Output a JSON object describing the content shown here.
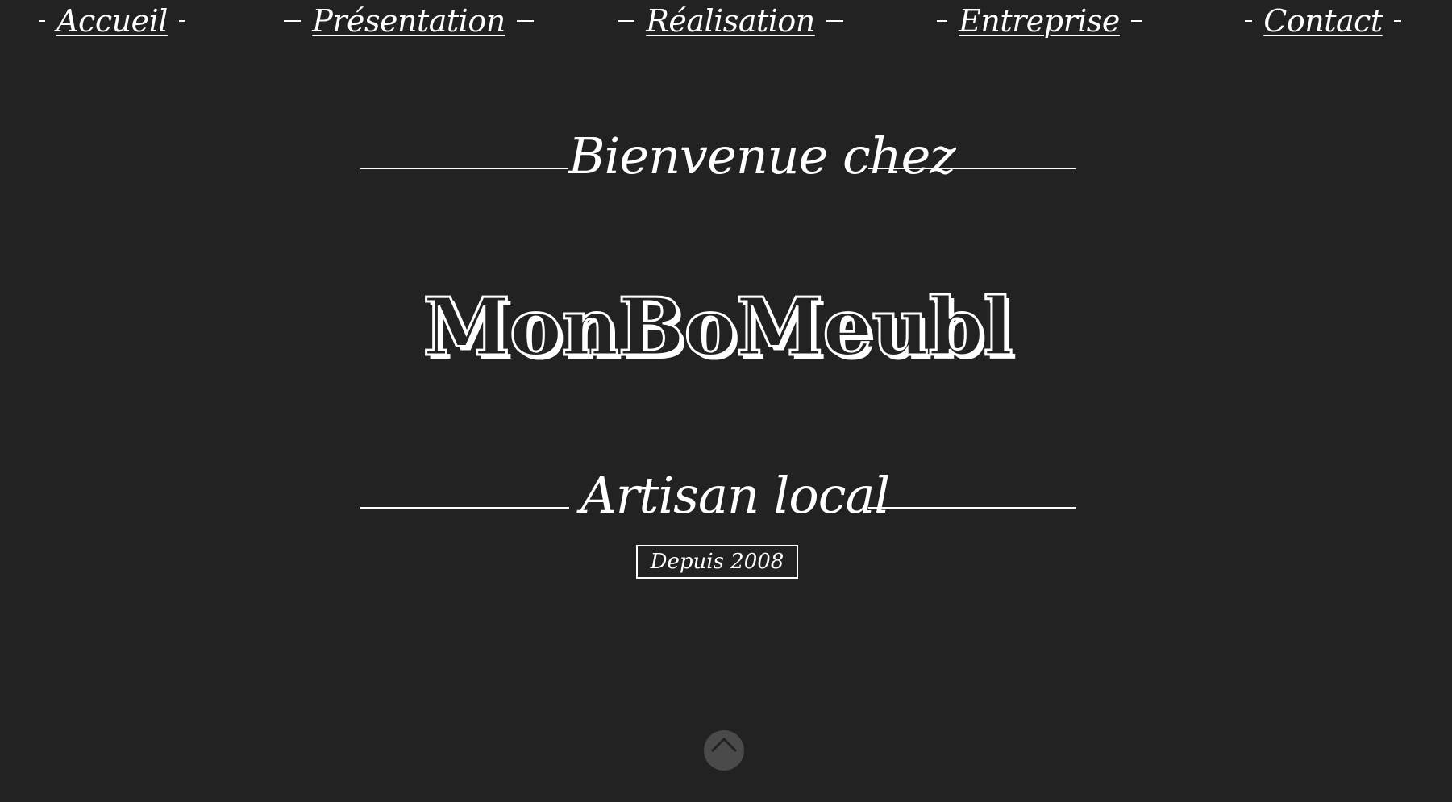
{
  "nav": {
    "items": [
      {
        "label": "Accueil"
      },
      {
        "label": "Présentation"
      },
      {
        "label": "Réalisation"
      },
      {
        "label": "Entreprise"
      },
      {
        "label": "Contact"
      }
    ]
  },
  "hero": {
    "welcome": "Bienvenue chez",
    "brand": "MonBoMeubl",
    "tagline": "Artisan local",
    "since": "Depuis 2008"
  },
  "scroll_top": {
    "icon": "chevron-up-icon"
  },
  "colors": {
    "background": "#222222",
    "text": "#ffffff",
    "scroll_button": "#4a4a4a"
  }
}
